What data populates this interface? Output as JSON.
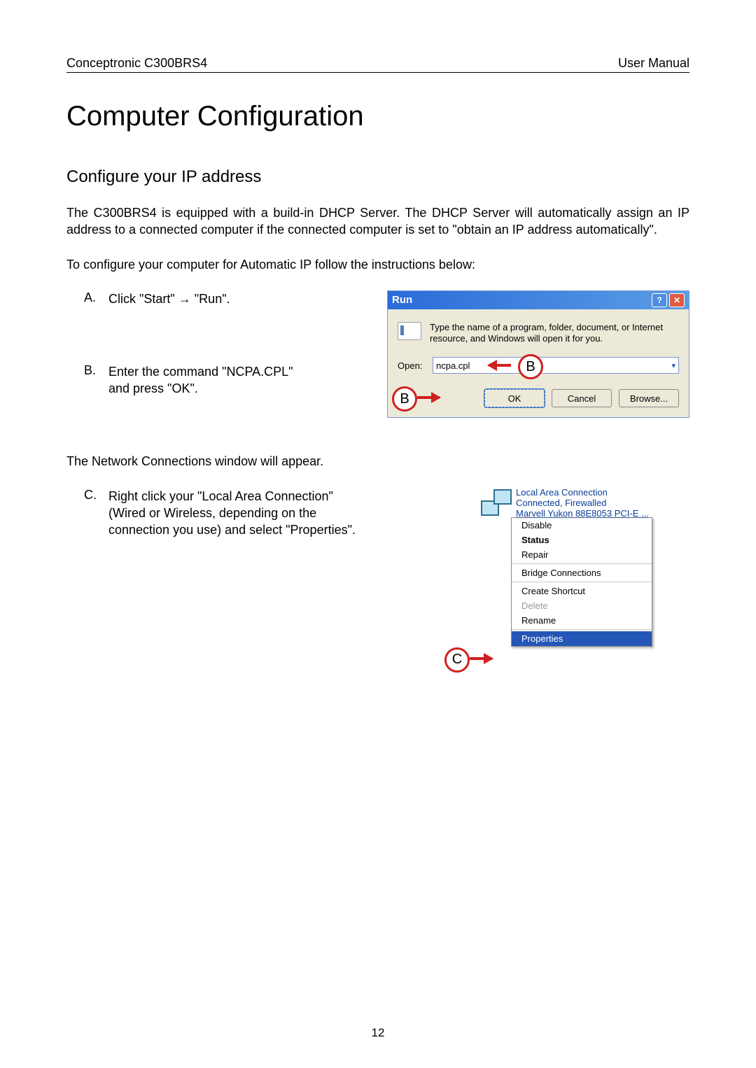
{
  "header": {
    "left": "Conceptronic C300BRS4",
    "right": "User Manual"
  },
  "title": "Computer Configuration",
  "subtitle": "Configure your IP address",
  "intro1": "The C300BRS4 is equipped with a build-in DHCP Server. The DHCP Server will automatically assign an IP address to a connected computer if the connected computer is set to \"obtain an IP address automatically\".",
  "intro2": "To configure your computer for Automatic IP follow the instructions below:",
  "step_a": {
    "letter": "A.",
    "text": "Click \"Start\" → \"Run\"."
  },
  "step_b": {
    "letter": "B.",
    "text": "Enter the command \"NCPA.CPL\" and press \"OK\"."
  },
  "after_b": "The Network Connections window will appear.",
  "step_c": {
    "letter": "C.",
    "text": "Right click your \"Local Area Connection\" (Wired or Wireless, depending on the connection you use) and select \"Properties\"."
  },
  "run_dialog": {
    "title": "Run",
    "message": "Type the name of a program, folder, document, or Internet resource, and Windows will open it for you.",
    "open_label": "Open:",
    "open_value": "ncpa.cpl",
    "ok": "OK",
    "cancel": "Cancel",
    "browse": "Browse..."
  },
  "callouts": {
    "b": "B",
    "c": "C"
  },
  "lan": {
    "title": "Local Area Connection",
    "status": "Connected, Firewalled",
    "device": "Marvell Yukon 88E8053 PCI-E ..."
  },
  "context_menu": {
    "disable": "Disable",
    "status": "Status",
    "repair": "Repair",
    "bridge": "Bridge Connections",
    "shortcut": "Create Shortcut",
    "delete": "Delete",
    "rename": "Rename",
    "properties": "Properties"
  },
  "page_number": "12"
}
